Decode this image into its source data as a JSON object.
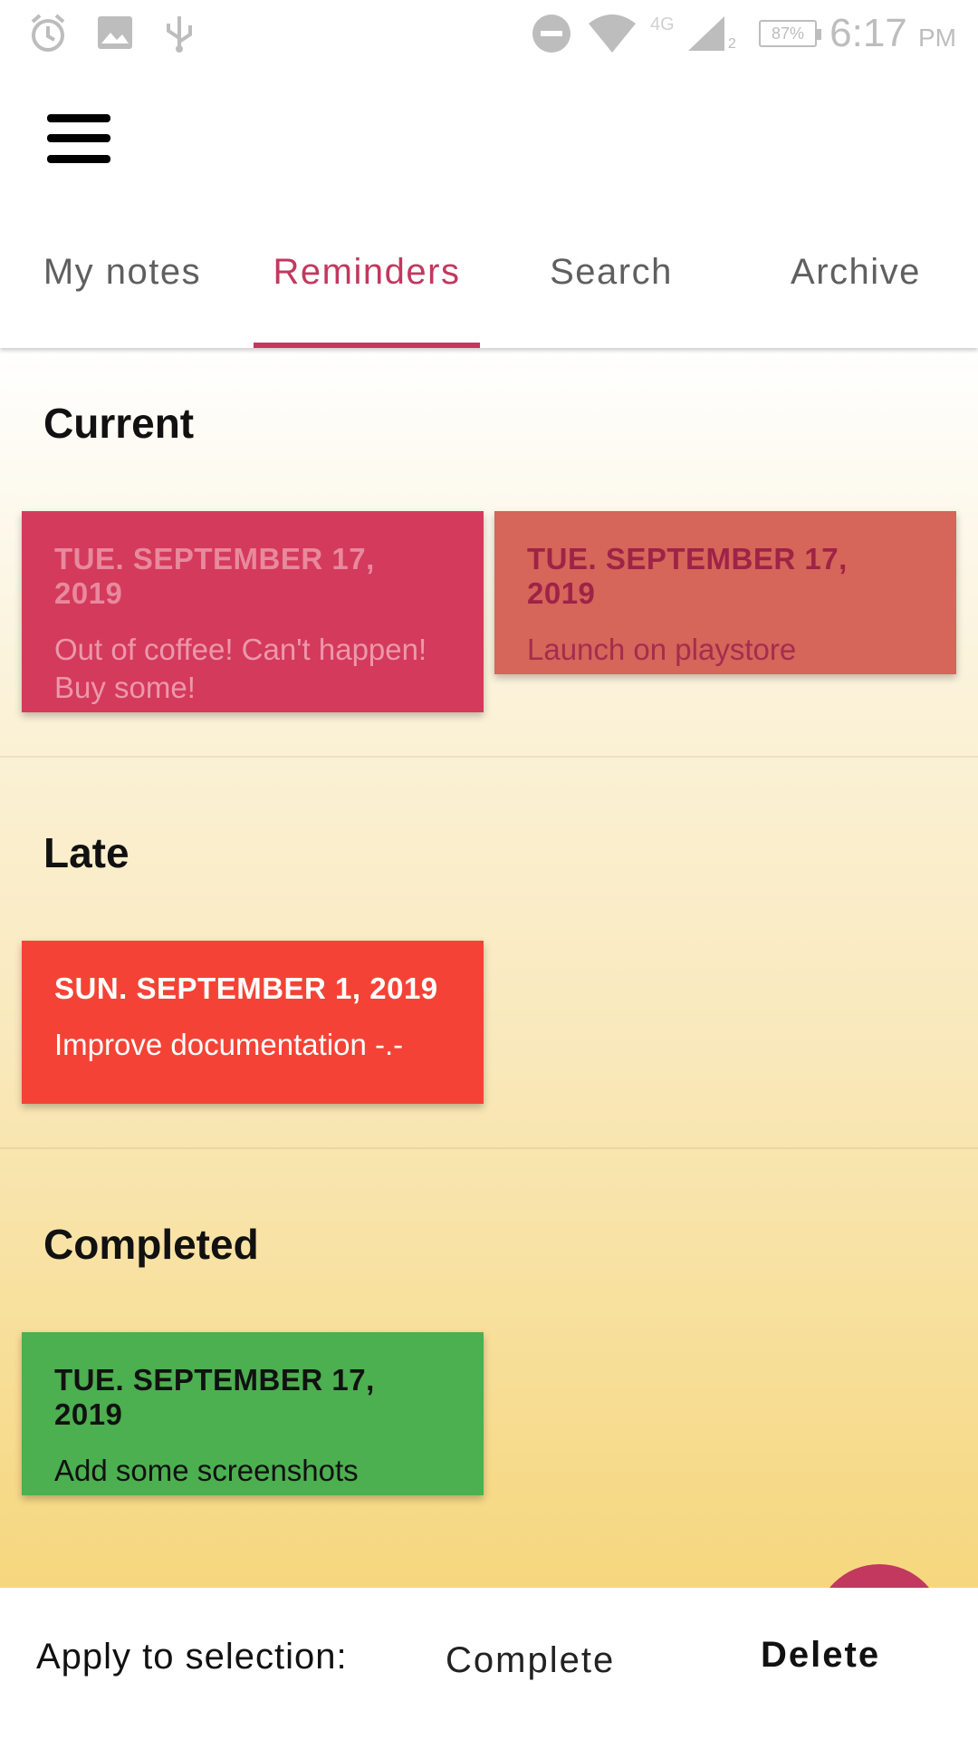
{
  "status_bar": {
    "icons": [
      "alarm-icon",
      "image-icon",
      "usb-icon",
      "do-not-disturb-icon",
      "wifi-icon",
      "signal-icon"
    ],
    "network_label": "4G",
    "sim_label": "2",
    "battery": "87%",
    "time": "6:17",
    "ampm": "PM"
  },
  "toolbar": {
    "menu_icon": "hamburger-menu-icon"
  },
  "tabs": [
    {
      "label": "My notes"
    },
    {
      "label": "Reminders",
      "active": true
    },
    {
      "label": "Search"
    },
    {
      "label": "Archive"
    }
  ],
  "sections": {
    "current": {
      "title": "Current",
      "cards": [
        {
          "date": "TUE. SEPTEMBER 17, 2019",
          "text": "Out of coffee! Can't happen! Buy some!",
          "color": "#d43a5c"
        },
        {
          "date": "TUE. SEPTEMBER 17, 2019",
          "text": "Launch on playstore",
          "color": "#d6655a"
        }
      ]
    },
    "late": {
      "title": "Late",
      "cards": [
        {
          "date": "SUN. SEPTEMBER 1, 2019",
          "text": "Improve documentation -.-",
          "color": "#f44336"
        }
      ]
    },
    "completed": {
      "title": "Completed",
      "cards": [
        {
          "date": "TUE. SEPTEMBER 17, 2019",
          "text": "Add some screenshots",
          "color": "#4caf50"
        }
      ]
    }
  },
  "action_bar": {
    "label": "Apply to selection:",
    "complete": "Complete",
    "delete": "Delete"
  },
  "colors": {
    "accent": "#c2385f"
  }
}
